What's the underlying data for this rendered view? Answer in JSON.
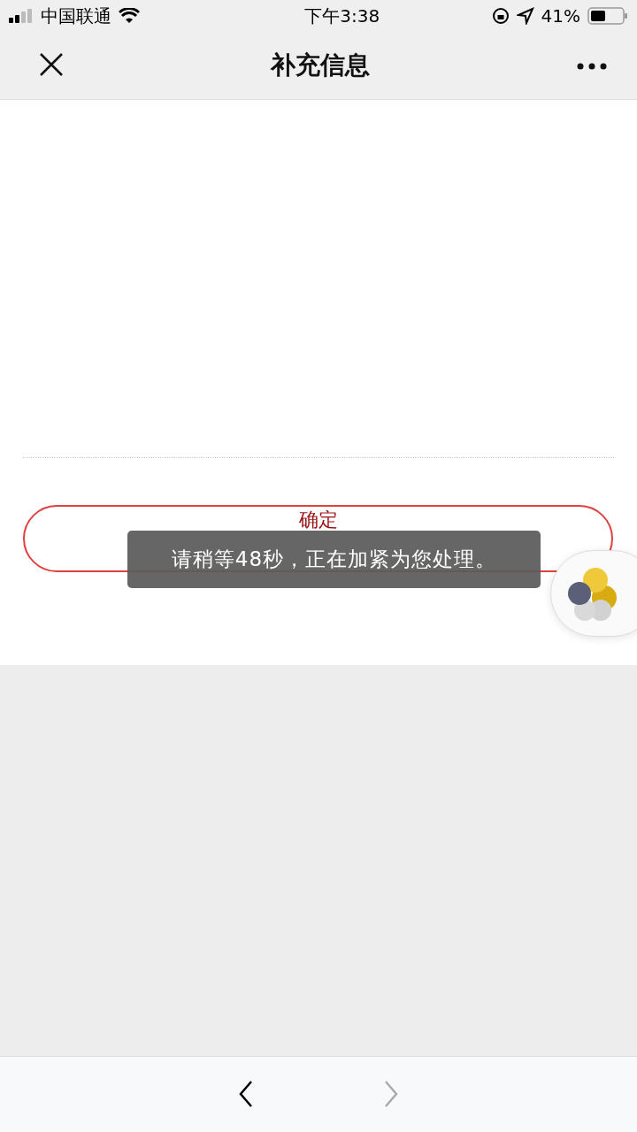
{
  "status_bar": {
    "carrier": "中国联通",
    "time": "下午3:38",
    "battery": "41%"
  },
  "nav": {
    "title": "补充信息"
  },
  "confirm_button": {
    "label": "确定"
  },
  "toast": {
    "text": "请稍等48秒，正在加紧为您处理。"
  },
  "toolbar": {
    "back": {
      "disabled": false
    },
    "forward": {
      "disabled": true
    }
  }
}
